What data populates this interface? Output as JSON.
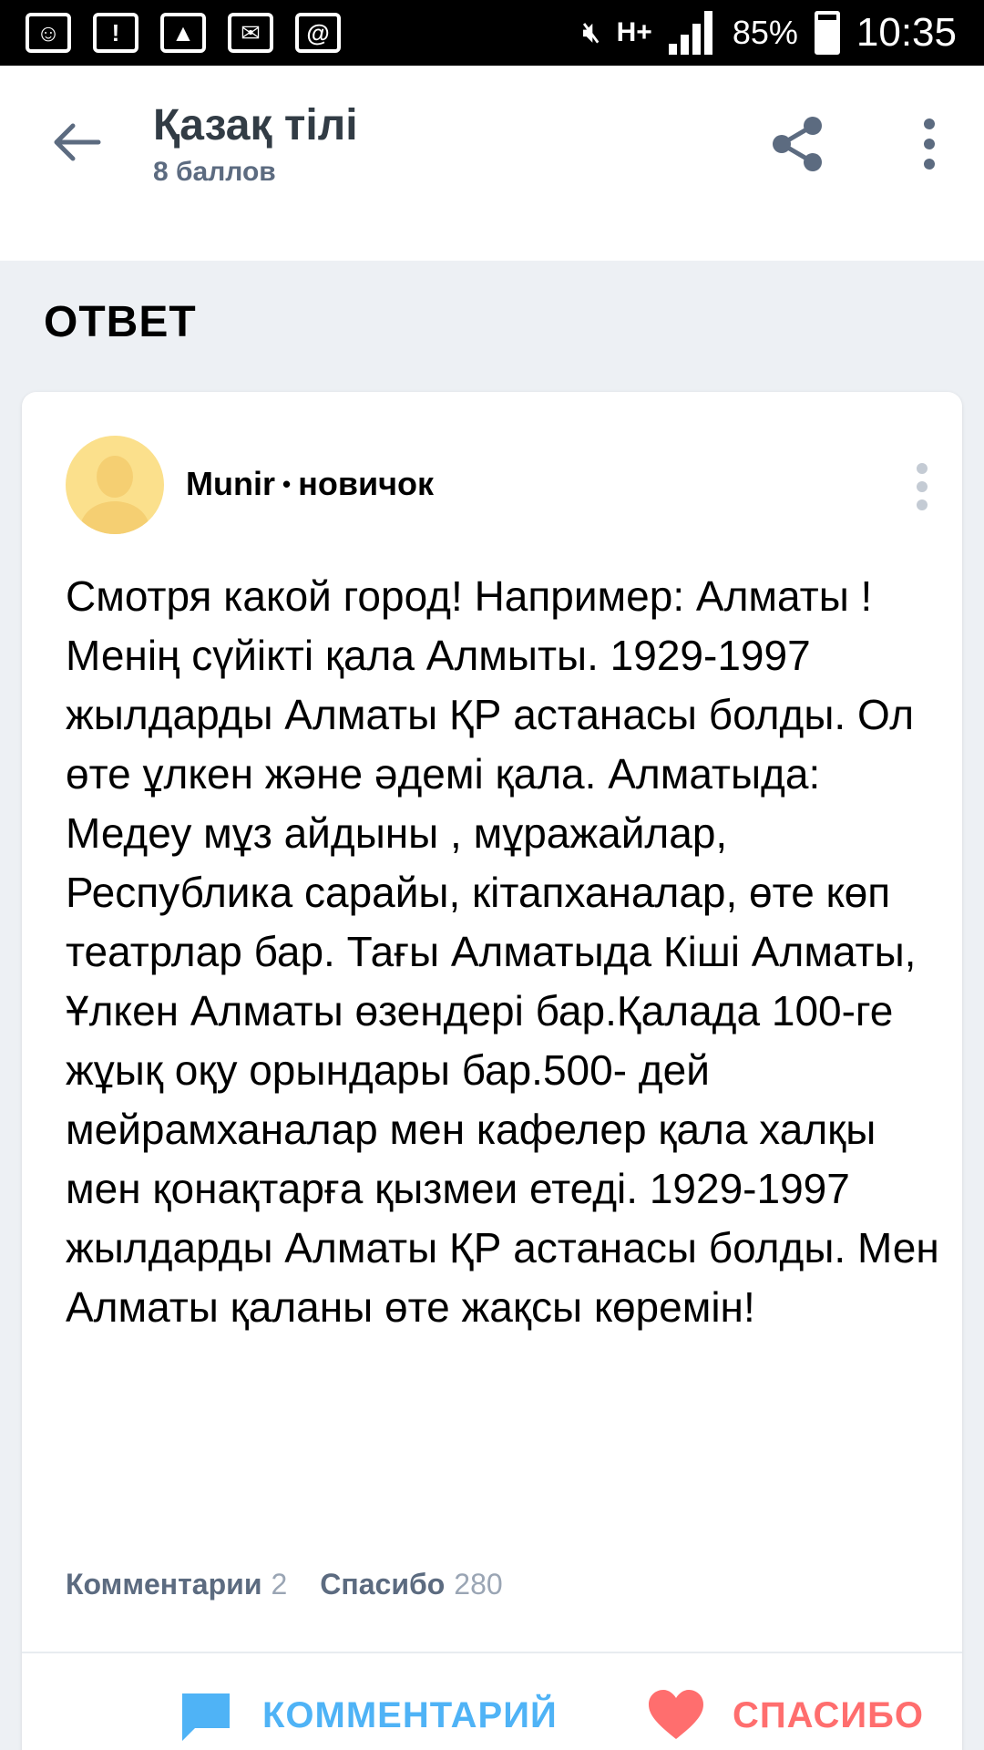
{
  "status_bar": {
    "battery_percent": "85%",
    "time": "10:35",
    "network": "H+",
    "icons": [
      "emoji-icon",
      "alert-icon",
      "image-icon",
      "mail-icon",
      "mail-at-icon",
      "mute-icon",
      "signal-icon",
      "battery-icon"
    ]
  },
  "header": {
    "title": "Қазақ тілі",
    "subtitle": "8 баллов",
    "icons": [
      "back-arrow-icon",
      "share-icon",
      "more-vert-icon"
    ]
  },
  "section_heading": "ОТВЕТ",
  "answer": {
    "author_name": "Munir",
    "separator": "•",
    "author_rank": "новичок",
    "text": "Смотря какой город! Например: Алматы ! Менің сүйікті қала Алмыты. 1929-1997 жылдарды Алматы ҚР астанасы болды. Ол өте ұлкен және әдемі қала. Алматыда: Медеу мұз айдыны , мұражайлар, Республика сарайы, кітапханалар, өте көп театрлар бар. Тағы Алматыда Кіші Алматы, Ұлкен Алматы өзендері бар.Қалада 100-ге жұық оқу орындары бар.500- дей мейрамханалар мен кафелер қала халқы мен қонақтарға қызмеи етеді. 1929-1997 жылдарды Алматы ҚР астанасы болды. Мен Алматы қаланы өте жақсы көремін!",
    "comments_label": "Комментарии",
    "comments_count": "2",
    "thanks_label": "Спасибо",
    "thanks_count": "280"
  },
  "actions": {
    "comment_label": "КОММЕНТАРИЙ",
    "thanks_label": "СПАСИБО"
  },
  "colors": {
    "accent_blue": "#4fb3f6",
    "accent_red": "#ff6e6e",
    "background": "#edf0f4",
    "muted_text": "#5c6b80"
  }
}
